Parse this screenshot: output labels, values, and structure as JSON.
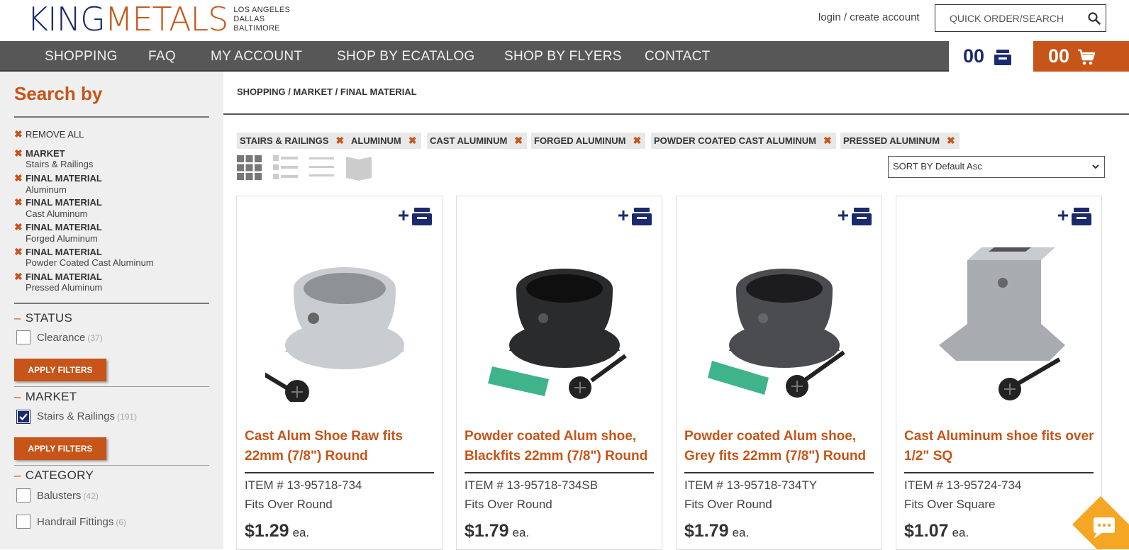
{
  "header": {
    "logo_part1": "KING",
    "logo_part2": "METALS",
    "cities": [
      "LOS ANGELES",
      "DALLAS",
      "BALTIMORE"
    ],
    "login_link": "login / create account",
    "search_placeholder": "QUICK ORDER/SEARCH"
  },
  "nav": {
    "items": [
      "SHOPPING",
      "FAQ",
      "MY ACCOUNT",
      "SHOP BY ECATALOG",
      "SHOP BY FLYERS",
      "CONTACT"
    ],
    "quote_count": "00",
    "cart_count": "00"
  },
  "sidebar": {
    "title": "Search by",
    "remove_all": "REMOVE ALL",
    "active_filters": [
      {
        "key": "MARKET",
        "value": "Stairs & Railings"
      },
      {
        "key": "FINAL MATERIAL",
        "value": "Aluminum"
      },
      {
        "key": "FINAL MATERIAL",
        "value": "Cast Aluminum"
      },
      {
        "key": "FINAL MATERIAL",
        "value": "Forged Aluminum"
      },
      {
        "key": "FINAL MATERIAL",
        "value": "Powder Coated Cast Aluminum"
      },
      {
        "key": "FINAL MATERIAL",
        "value": "Pressed Aluminum"
      }
    ],
    "status": {
      "title": "STATUS",
      "option": "Clearance",
      "count": "(37)",
      "checked": false
    },
    "apply_label": "APPLY FILTERS",
    "market": {
      "title": "MARKET",
      "option": "Stairs & Railings",
      "count": "(191)",
      "checked": true
    },
    "category": {
      "title": "CATEGORY",
      "options": [
        {
          "label": "Balusters",
          "count": "(42)"
        },
        {
          "label": "Handrail Fittings",
          "count": "(6)"
        }
      ]
    }
  },
  "main": {
    "breadcrumb": "SHOPPING / MARKET / FINAL MATERIAL",
    "chips": [
      "STAIRS & RAILINGS",
      "ALUMINUM",
      "CAST ALUMINUM",
      "FORGED ALUMINUM",
      "POWDER COATED CAST ALUMINUM",
      "PRESSED ALUMINUM"
    ],
    "sort_label": "SORT BY Default Asc",
    "products": [
      {
        "name": "Cast Alum Shoe Raw fits 22mm (7/8\") Round",
        "sku": "ITEM # 13-95718-734",
        "desc": "Fits Over Round",
        "price": "$1.29",
        "unit": "ea.",
        "color": "#c9ccd0"
      },
      {
        "name": "Powder coated Alum shoe, Blackfits 22mm (7/8\") Round",
        "sku": "ITEM # 13-95718-734SB",
        "desc": "Fits Over Round",
        "price": "$1.79",
        "unit": "ea.",
        "color": "#2a2b2d"
      },
      {
        "name": "Powder coated Alum shoe, Grey fits 22mm (7/8\") Round",
        "sku": "ITEM # 13-95718-734TY",
        "desc": "Fits Over Round",
        "price": "$1.79",
        "unit": "ea.",
        "color": "#4a4c50"
      },
      {
        "name": "Cast Aluminum shoe fits over 1/2\" SQ",
        "sku": "ITEM # 13-95724-734",
        "desc": "Fits Over Square",
        "price": "$1.07",
        "unit": "ea.",
        "color": "#a8abaf"
      }
    ]
  },
  "colors": {
    "brand_orange": "#c75418",
    "brand_navy": "#1a2a6c",
    "nav_bg": "#575757"
  }
}
